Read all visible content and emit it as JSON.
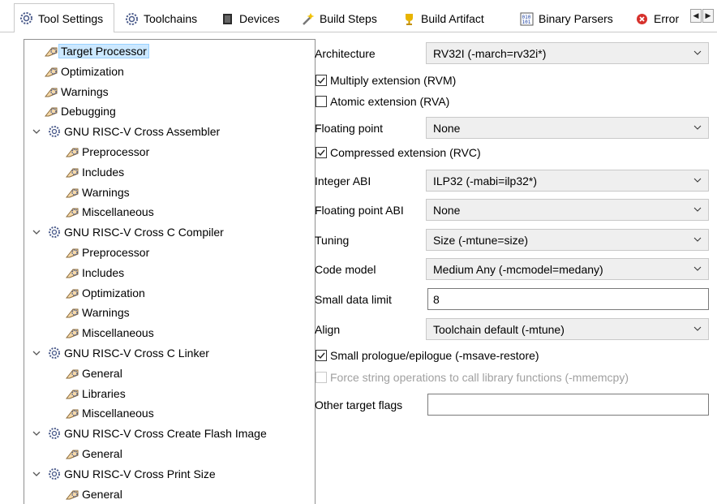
{
  "tabs": [
    {
      "label": "Tool Settings",
      "icon": "gear-icon",
      "active": true
    },
    {
      "label": "Toolchains",
      "icon": "gear-icon"
    },
    {
      "label": "Devices",
      "icon": "chip-icon"
    },
    {
      "label": "Build Steps",
      "icon": "wand-icon"
    },
    {
      "label": "Build Artifact",
      "icon": "trophy-icon"
    },
    {
      "label": "Binary Parsers",
      "icon": "binary-icon"
    },
    {
      "label": "Error",
      "icon": "error-icon"
    }
  ],
  "tab_scroll": {
    "left": "◀",
    "right": "▶"
  },
  "tree": {
    "items": [
      {
        "label": "Target Processor",
        "level": 1,
        "selected": true
      },
      {
        "label": "Optimization",
        "level": 1
      },
      {
        "label": "Warnings",
        "level": 1
      },
      {
        "label": "Debugging",
        "level": 1
      },
      {
        "label": "GNU RISC-V Cross Assembler",
        "level": 0,
        "expanded": true
      },
      {
        "label": "Preprocessor",
        "level": 2
      },
      {
        "label": "Includes",
        "level": 2
      },
      {
        "label": "Warnings",
        "level": 2
      },
      {
        "label": "Miscellaneous",
        "level": 2
      },
      {
        "label": "GNU RISC-V Cross C Compiler",
        "level": 0,
        "expanded": true
      },
      {
        "label": "Preprocessor",
        "level": 2
      },
      {
        "label": "Includes",
        "level": 2
      },
      {
        "label": "Optimization",
        "level": 2
      },
      {
        "label": "Warnings",
        "level": 2
      },
      {
        "label": "Miscellaneous",
        "level": 2
      },
      {
        "label": "GNU RISC-V Cross C Linker",
        "level": 0,
        "expanded": true
      },
      {
        "label": "General",
        "level": 2
      },
      {
        "label": "Libraries",
        "level": 2
      },
      {
        "label": "Miscellaneous",
        "level": 2
      },
      {
        "label": "GNU RISC-V Cross Create Flash Image",
        "level": 0,
        "expanded": true
      },
      {
        "label": "General",
        "level": 2
      },
      {
        "label": "GNU RISC-V Cross Print Size",
        "level": 0,
        "expanded": true
      },
      {
        "label": "General",
        "level": 2
      }
    ]
  },
  "settings": {
    "architecture": {
      "label": "Architecture",
      "value": "RV32I (-march=rv32i*)"
    },
    "multiply": {
      "label": "Multiply extension (RVM)",
      "checked": true
    },
    "atomic": {
      "label": "Atomic extension (RVA)",
      "checked": false
    },
    "floating_point": {
      "label": "Floating point",
      "value": "None"
    },
    "compressed": {
      "label": "Compressed extension (RVC)",
      "checked": true
    },
    "integer_abi": {
      "label": "Integer ABI",
      "value": "ILP32 (-mabi=ilp32*)"
    },
    "fp_abi": {
      "label": "Floating point ABI",
      "value": "None"
    },
    "tuning": {
      "label": "Tuning",
      "value": "Size (-mtune=size)"
    },
    "code_model": {
      "label": "Code model",
      "value": "Medium Any (-mcmodel=medany)"
    },
    "small_data": {
      "label": "Small data limit",
      "value": "8"
    },
    "align": {
      "label": "Align",
      "value": "Toolchain default (-mtune)"
    },
    "save_restore": {
      "label": "Small prologue/epilogue (-msave-restore)",
      "checked": true
    },
    "force_string": {
      "label": "Force string operations to call library functions (-mmemcpy)",
      "checked": false,
      "disabled": true
    },
    "other_flags": {
      "label": "Other target flags",
      "value": ""
    }
  },
  "colors": {
    "selection": "#cce8ff",
    "combo_bg": "#efefef",
    "border": "#c9c9c9"
  }
}
